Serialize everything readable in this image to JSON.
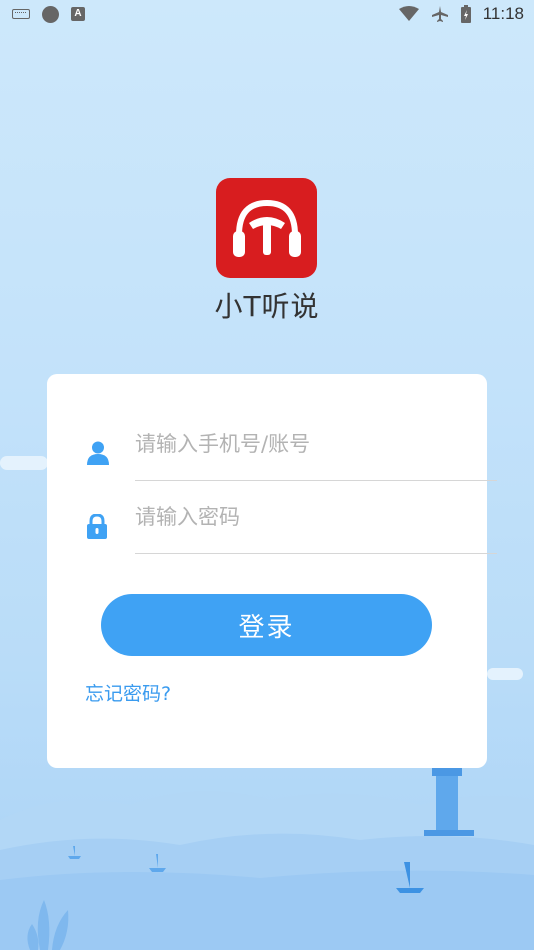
{
  "status_bar": {
    "time": "11:18",
    "left_icons": [
      "keyboard-icon",
      "circle-icon",
      "a-icon"
    ],
    "right_icons": [
      "wifi-icon",
      "airplane-icon",
      "battery-charging-icon"
    ]
  },
  "app": {
    "name": "小T听说",
    "logo_icon": "headphones-t-icon",
    "logo_color": "#d81d1f"
  },
  "login": {
    "account_placeholder": "请输入手机号/账号",
    "account_value": "",
    "account_icon": "user-icon",
    "password_placeholder": "请输入密码",
    "password_value": "",
    "password_icon": "lock-icon",
    "submit_label": "登录",
    "forgot_label": "忘记密码?"
  },
  "colors": {
    "accent": "#3fa2f4",
    "link": "#3a9bef",
    "background": "#c3e2fa"
  }
}
